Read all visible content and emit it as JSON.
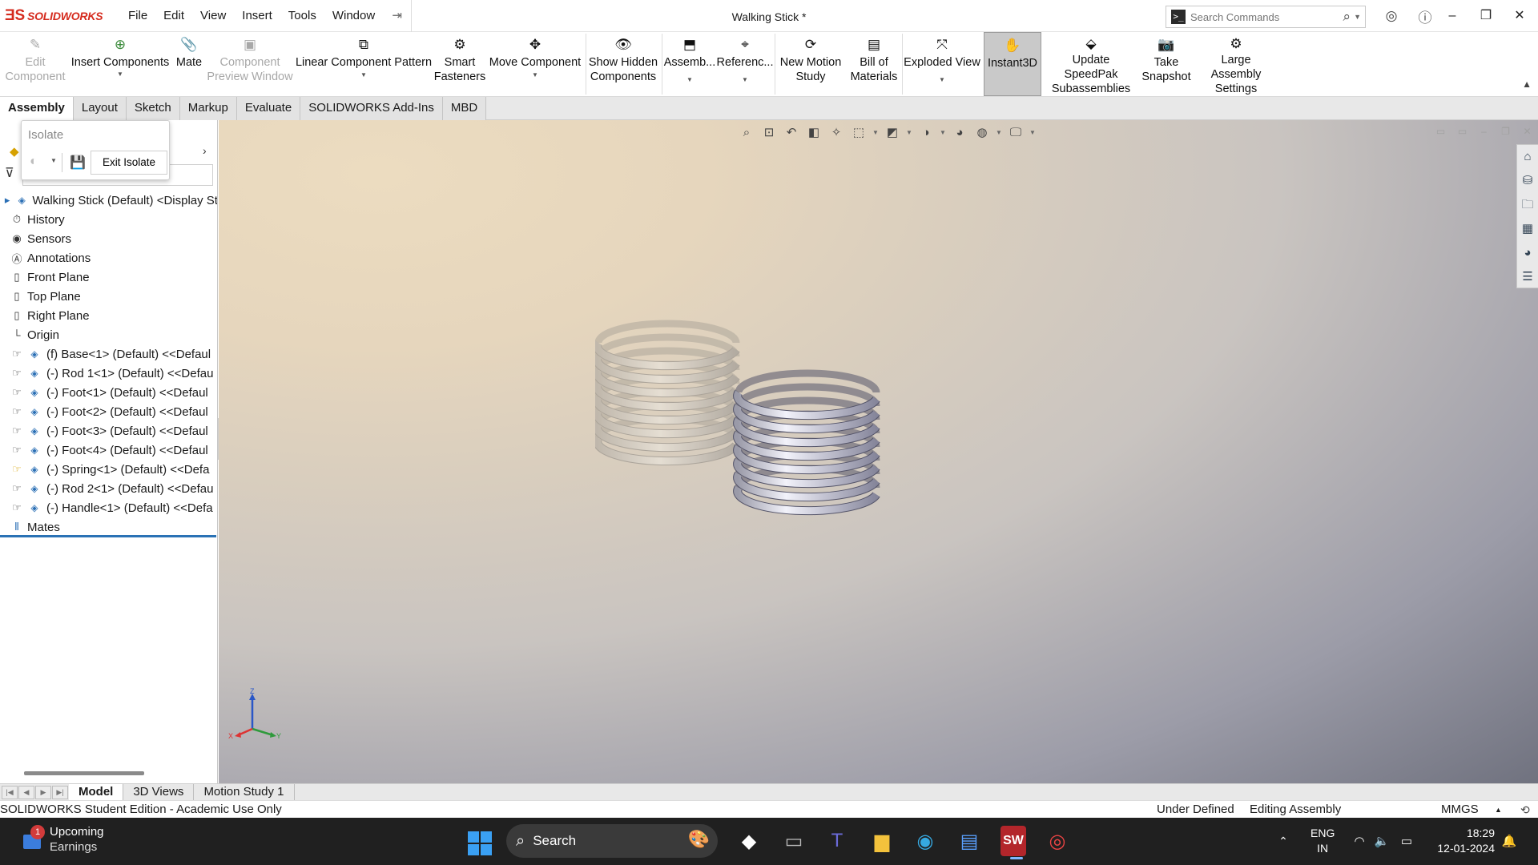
{
  "app": {
    "brand": "SOLIDWORKS",
    "document_title": "Walking Stick *"
  },
  "menu": [
    "File",
    "Edit",
    "View",
    "Insert",
    "Tools",
    "Window"
  ],
  "search": {
    "placeholder": "Search Commands"
  },
  "ribbon": {
    "edit_component": "Edit Component",
    "insert_components": "Insert Components",
    "mate": "Mate",
    "component_preview_window": "Component Preview Window",
    "linear_component_pattern": "Linear Component Pattern",
    "smart_fasteners": "Smart Fasteners",
    "move_component": "Move Component",
    "show_hidden_components": "Show Hidden Components",
    "assemb": "Assemb...",
    "referenc": "Referenc...",
    "new_motion_study": "New Motion Study",
    "bill_of_materials": "Bill of Materials",
    "exploded_view": "Exploded View",
    "instant3d": "Instant3D",
    "update_speedpak": "Update SpeedPak Subassemblies",
    "take_snapshot": "Take Snapshot",
    "large_assembly_settings": "Large Assembly Settings"
  },
  "tabs": [
    {
      "label": "Assembly",
      "active": true
    },
    {
      "label": "Layout"
    },
    {
      "label": "Sketch"
    },
    {
      "label": "Markup"
    },
    {
      "label": "Evaluate"
    },
    {
      "label": "SOLIDWORKS Add-Ins"
    },
    {
      "label": "MBD"
    }
  ],
  "isolate": {
    "title": "Isolate",
    "exit_label": "Exit Isolate"
  },
  "tree": [
    {
      "label": "Walking Stick (Default) <Display St",
      "icon": "assembly-icon"
    },
    {
      "label": "History",
      "icon": "history-icon"
    },
    {
      "label": "Sensors",
      "icon": "sensors-icon"
    },
    {
      "label": "Annotations",
      "icon": "annotations-icon"
    },
    {
      "label": "Front Plane",
      "icon": "plane-icon"
    },
    {
      "label": "Top Plane",
      "icon": "plane-icon"
    },
    {
      "label": "Right Plane",
      "icon": "plane-icon"
    },
    {
      "label": "Origin",
      "icon": "origin-icon"
    },
    {
      "label": "(f) Base<1> (Default) <<Defaul",
      "icon": "part-icon"
    },
    {
      "label": "(-) Rod 1<1> (Default) <<Defau",
      "icon": "part-icon"
    },
    {
      "label": "(-) Foot<1> (Default) <<Defaul",
      "icon": "part-icon"
    },
    {
      "label": "(-) Foot<2> (Default) <<Defaul",
      "icon": "part-icon"
    },
    {
      "label": "(-) Foot<3> (Default) <<Defaul",
      "icon": "part-icon"
    },
    {
      "label": "(-) Foot<4> (Default) <<Defaul",
      "icon": "part-icon"
    },
    {
      "label": "(-) Spring<1> (Default) <<Defa",
      "icon": "part-icon",
      "highlight": true
    },
    {
      "label": "(-) Rod 2<1> (Default) <<Defau",
      "icon": "part-icon"
    },
    {
      "label": "(-) Handle<1> (Default) <<Defa",
      "icon": "part-icon"
    },
    {
      "label": "Mates",
      "icon": "mates-icon"
    }
  ],
  "bottom_tabs": [
    {
      "label": "Model",
      "active": true
    },
    {
      "label": "3D Views"
    },
    {
      "label": "Motion Study 1"
    }
  ],
  "status": {
    "edition": "SOLIDWORKS Student Edition - Academic Use Only",
    "state": "Under Defined",
    "mode": "Editing Assembly",
    "units": "MMGS"
  },
  "triad": {
    "x": "X",
    "y": "Y",
    "z": "Z"
  },
  "taskbar": {
    "weather_title": "Upcoming",
    "weather_sub": "Earnings",
    "badge": "1",
    "search": "Search",
    "lang1": "ENG",
    "lang2": "IN",
    "time": "18:29",
    "date": "12-01-2024"
  }
}
